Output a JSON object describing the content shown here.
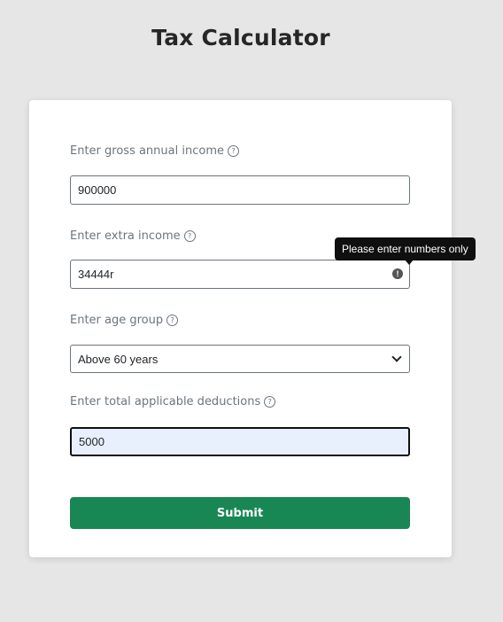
{
  "page": {
    "title": "Tax Calculator"
  },
  "form": {
    "gross_income": {
      "label": "Enter gross annual income",
      "value": "900000"
    },
    "extra_income": {
      "label": "Enter extra income",
      "value": "34444r",
      "error_tooltip": "Please enter numbers only"
    },
    "age_group": {
      "label": "Enter age group",
      "selected": "Above 60 years"
    },
    "deductions": {
      "label": "Enter total applicable deductions",
      "value": "5000"
    },
    "submit_label": "Submit",
    "help_glyph": "?",
    "error_glyph": "!"
  },
  "colors": {
    "background": "#e6e6e6",
    "card": "#ffffff",
    "submit": "#198754",
    "focused_input": "#e8f0fe",
    "tooltip": "#0f0f0f"
  },
  "icons": {
    "help": "question-circle-icon",
    "error": "exclamation-circle-icon",
    "select": "chevron-down-icon"
  }
}
